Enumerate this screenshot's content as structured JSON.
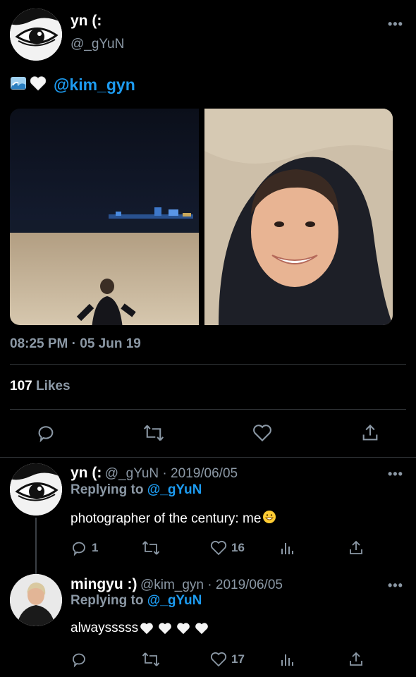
{
  "main_tweet": {
    "display_name": "yn (:",
    "handle": "@_gYuN",
    "text_mention": "@kim_gyn",
    "timestamp": "08:25 PM · 05 Jun 19",
    "likes_count": "107",
    "likes_label": "Likes"
  },
  "replies": [
    {
      "display_name": "yn (:",
      "meta": "@_gYuN · 2019/06/05",
      "replying_label": "Replying to",
      "replying_to": "@_gYuN",
      "text": "photographer of the century: me",
      "reply_count": "1",
      "like_count": "16"
    },
    {
      "display_name": "mingyu :)",
      "meta": "@kim_gyn · 2019/06/05",
      "replying_label": "Replying to",
      "replying_to": "@_gYuN",
      "text": "alwaysssss",
      "like_count": "17"
    }
  ],
  "colors": {
    "background": "#000000",
    "link": "#1d9bf0",
    "muted": "#8b98a5",
    "divider": "#2f3336"
  }
}
